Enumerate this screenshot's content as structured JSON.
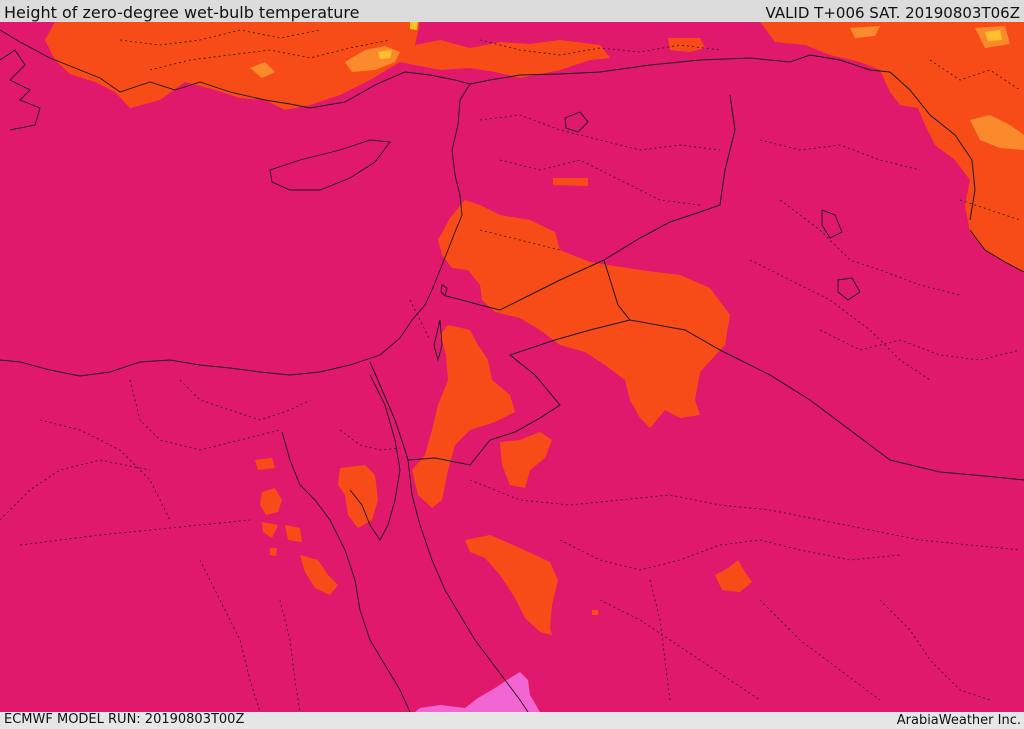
{
  "header": {
    "title": "Height of zero-degree wet-bulb temperature",
    "valid": "VALID T+006 SAT. 20190803T06Z"
  },
  "footer": {
    "model_run": "ECMWF MODEL RUN: 20190803T00Z",
    "credit": "ArabiaWeather Inc."
  },
  "colors": {
    "base": "#e0196c",
    "orange": "#f84c18",
    "light_orange": "#fb8a2c",
    "yellow": "#fcc12c",
    "pink": "#f266d3",
    "boundary": "#1a1a1a"
  }
}
